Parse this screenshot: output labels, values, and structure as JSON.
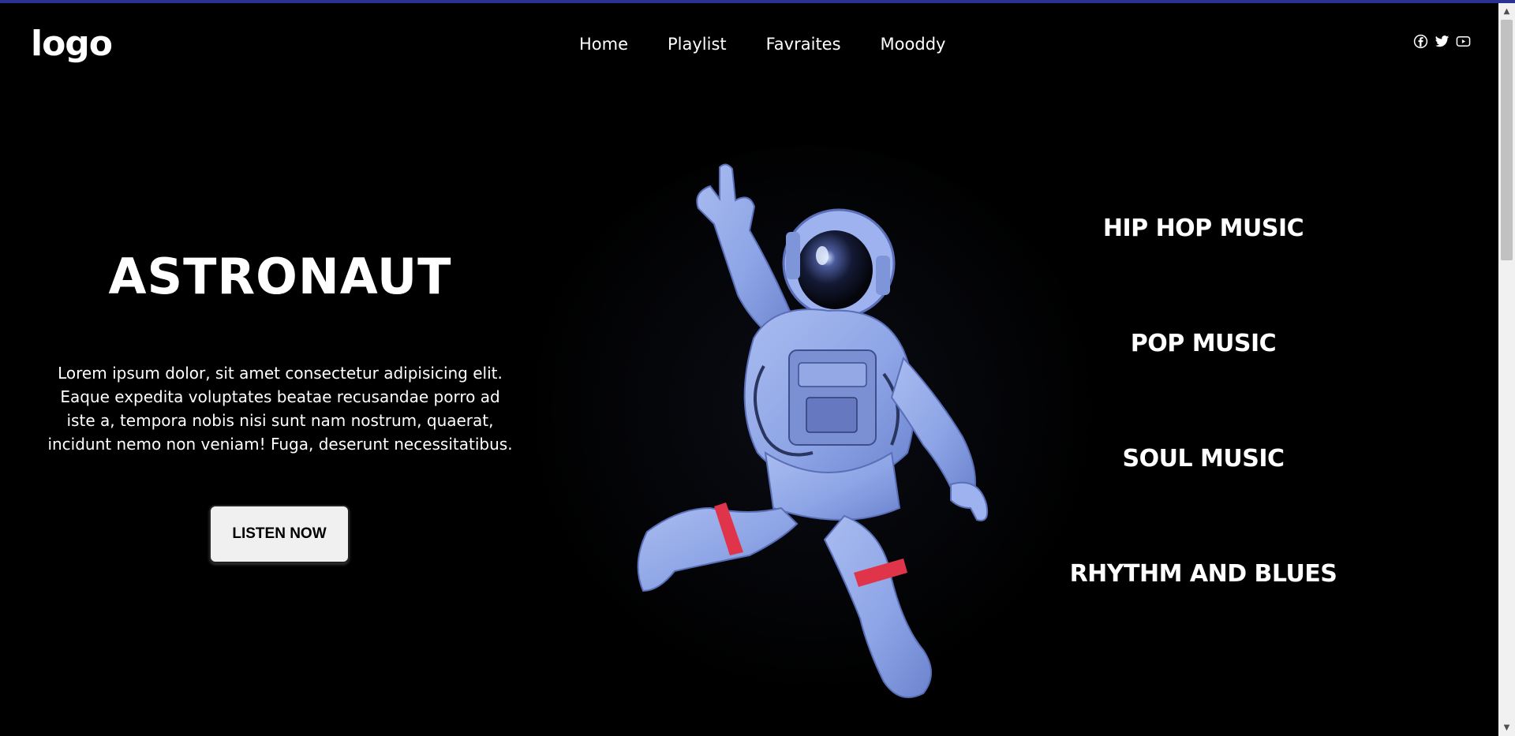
{
  "header": {
    "logo": "logo",
    "nav": [
      "Home",
      "Playlist",
      "Favraites",
      "Mooddy"
    ],
    "social_icons": [
      "facebook-icon",
      "twitter-icon",
      "youtube-icon"
    ]
  },
  "hero": {
    "title": "ASTRONAUT",
    "text": "Lorem ipsum dolor, sit amet consectetur adipisicing elit. Eaque expedita voluptates beatae recusandae porro ad iste a, tempora nobis nisi sunt nam nostrum, quaerat, incidunt nemo non veniam! Fuga, deserunt necessitatibus.",
    "button": "LISTEN NOW",
    "image": "astronaut-illustration"
  },
  "genres": [
    "HIP HOP MUSIC",
    "POP MUSIC",
    "SOUL MUSIC",
    "RHYTHM AND BLUES"
  ],
  "colors": {
    "background": "#000000",
    "top_strip": "#2b3191",
    "suit": "#8fa6e8",
    "stripe": "#e0344b"
  }
}
